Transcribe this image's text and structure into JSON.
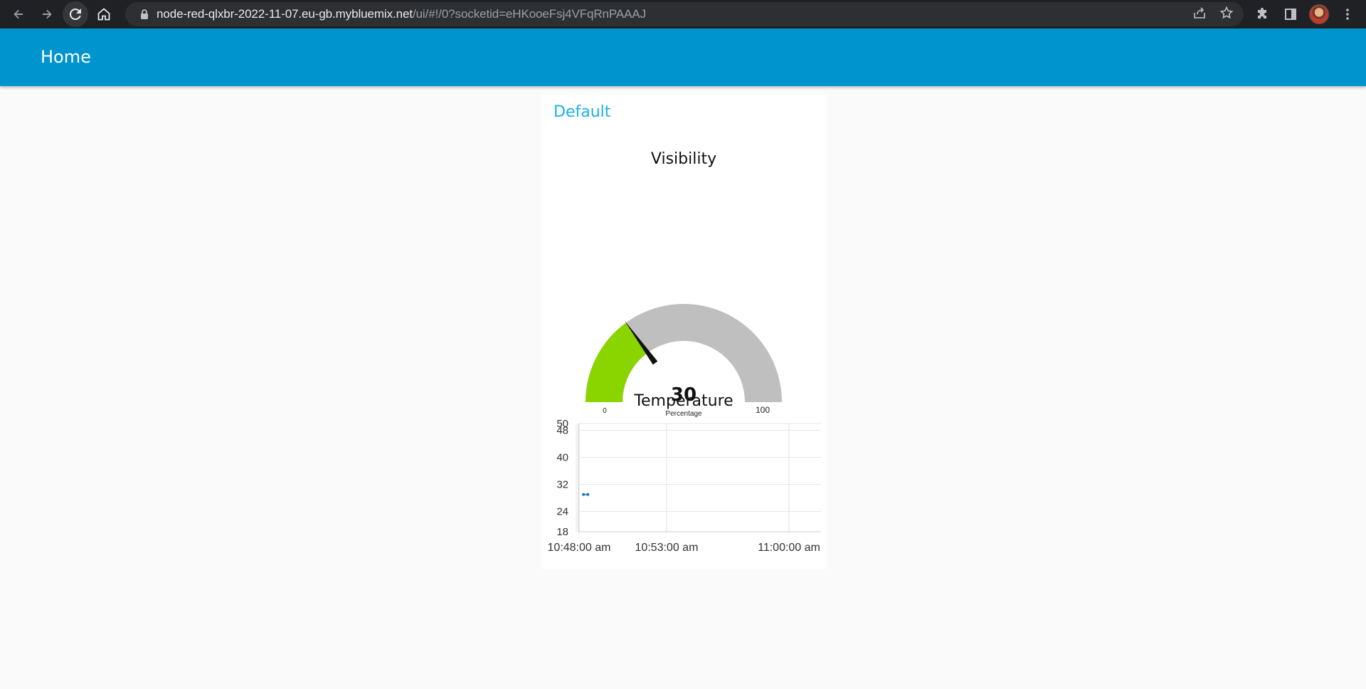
{
  "browser": {
    "url_host": "node-red-qlxbr-2022-11-07.eu-gb.mybluemix.net",
    "url_path": "/ui/#!/0?socketid=eHKooeFsj4VFqRnPAAAJ"
  },
  "toolbar": {
    "title": "Home"
  },
  "group": {
    "title": "Default"
  },
  "gauge": {
    "title": "Visibility",
    "value": 30,
    "value_label": "30",
    "units": "Percentage",
    "min": 0,
    "max": 100,
    "min_label": "0",
    "max_label": "100",
    "fill_color": "#8ad400",
    "track_color": "#bfbfbf",
    "needle_color": "#111111"
  },
  "chart": {
    "title": "Temperature"
  },
  "chart_data": {
    "type": "line",
    "title": "Temperature",
    "xlabel": "",
    "ylabel": "",
    "x_ticks": [
      "10:48:00 am",
      "10:53:00 am",
      "11:00:00 am"
    ],
    "y_ticks": [
      "50",
      "48",
      "40",
      "32",
      "24",
      "18"
    ],
    "ylim": [
      18,
      50
    ],
    "grid": true,
    "series": [
      {
        "color": "#1f77b4",
        "x": [
          "10:48:15 am",
          "10:48:30 am"
        ],
        "values": [
          29,
          29
        ]
      }
    ]
  }
}
